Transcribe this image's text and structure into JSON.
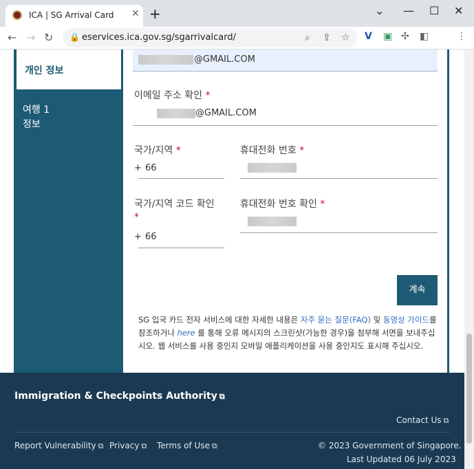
{
  "browser": {
    "tab_title": "ICA | SG Arrival Card",
    "tab_close": "✕",
    "new_tab": "+",
    "url": "eservices.ica.gov.sg/sgarrivalcard/"
  },
  "sidebar": {
    "items": [
      {
        "label": "개인 정보"
      },
      {
        "label_line1": "여행 1",
        "label_line2": "정보"
      }
    ]
  },
  "form": {
    "email_value": "@GMAIL.COM",
    "confirm_email_label": "이메일 주소 확인",
    "confirm_email_value": "@GMAIL.COM",
    "country_label": "국가/지역",
    "country_prefix": "+",
    "country_value": "66",
    "mobile_label": "휴대전화 번호",
    "country_confirm_label": "국가/지역 코드 확인",
    "country_confirm_prefix": "+",
    "country_confirm_value": "66",
    "mobile_confirm_label": "휴대전화 번호 확인",
    "required_mark": "*",
    "continue_label": "계속"
  },
  "help": {
    "part1": "SG 입국 카드 전자 서비스에 대한 자세한 내용은 ",
    "faq_link": "자주 묻는 질문(FAQ)",
    "part2": " 및 ",
    "video_link": "동영상 가이드",
    "part3": "를 참조하거나 ",
    "here_link": "here",
    "part4": " 를 통해 오류 메시지의 스크린샷(가능한 경우)을 첨부해 서면을 보내주십시오. 웹 서비스를 사용 중인지 모바일 애플리케이션을 사용 중인지도 표시해 주십시오."
  },
  "footer": {
    "authority": "Immigration & Checkpoints Authority",
    "contact": "Contact Us",
    "report": "Report Vulnerability",
    "privacy": "Privacy",
    "terms": "Terms of Use",
    "copyright": "© 2023 Government of Singapore.",
    "updated": "Last Updated 06 July 2023"
  },
  "colors": {
    "brand_teal": "#1d5a74",
    "footer_bg": "#1b3a52",
    "required": "#c8102e",
    "link": "#2f6fbf"
  }
}
